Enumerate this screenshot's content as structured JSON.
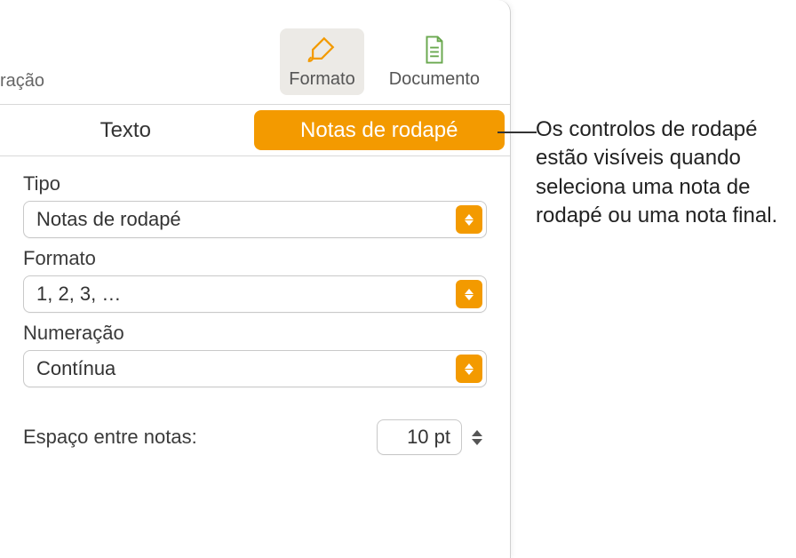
{
  "toolbar": {
    "left_fragment": "ração",
    "format_label": "Formato",
    "document_label": "Documento"
  },
  "tabs": {
    "text": "Texto",
    "footnotes": "Notas de rodapé"
  },
  "fields": {
    "type_label": "Tipo",
    "type_value": "Notas de rodapé",
    "format_label": "Formato",
    "format_value": "1, 2, 3, …",
    "numbering_label": "Numeração",
    "numbering_value": "Contínua",
    "spacing_label": "Espaço entre notas:",
    "spacing_value": "10 pt"
  },
  "callout": "Os controlos de rodapé estão visíveis quando seleciona uma nota de rodapé ou uma nota final.",
  "colors": {
    "accent": "#f39a00"
  }
}
